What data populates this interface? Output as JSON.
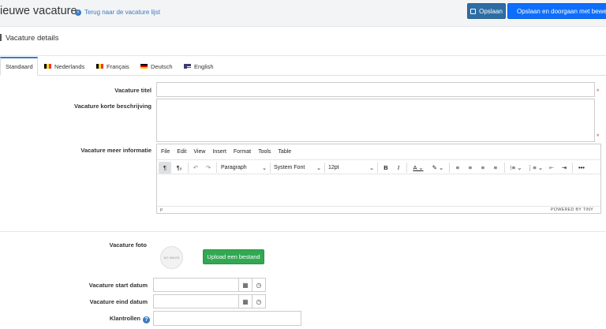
{
  "header": {
    "title": "ieuwe vacature",
    "back_link": "Terug naar de vacature lijst",
    "save_label": "Opslaan",
    "save_continue_label": "Opslaan en doorgaan met bewerken",
    "save_icon": "save-icon"
  },
  "section": {
    "title": "Vacature details"
  },
  "tabs": [
    {
      "label": "Standaard"
    },
    {
      "label": "Nederlands",
      "flag": "be"
    },
    {
      "label": "Français",
      "flag": "be"
    },
    {
      "label": "Deutsch",
      "flag": "de"
    },
    {
      "label": "English",
      "flag": "us"
    }
  ],
  "form": {
    "titel_label": "Vacature titel",
    "titel_value": "",
    "korte_label": "Vacature korte beschrijving",
    "korte_value": "",
    "meer_label": "Vacature meer informatie",
    "foto_label": "Vacature foto",
    "no_image_text": "NO IMAGE",
    "upload_label": "Upload een bestand",
    "start_label": "Vacature start datum",
    "start_value": "",
    "eind_label": "Vacature eind datum",
    "eind_value": "",
    "klantrollen_label": "Klantrollen",
    "klantrollen_value": "",
    "required_mark": "*"
  },
  "editor": {
    "menu": [
      "File",
      "Edit",
      "View",
      "Insert",
      "Format",
      "Tools",
      "Table"
    ],
    "block_format": "Paragraph",
    "font_family": "System Font",
    "font_size": "12pt",
    "status_path": "p",
    "powered_by": "POWERED BY TINY",
    "bold": "B",
    "italic": "I",
    "more": "•••"
  },
  "colors": {
    "primary": "#2e6da4",
    "primary_bright": "#0d6efd",
    "success": "#33a852",
    "link": "#3b7bbf",
    "required": "#d9534f"
  }
}
